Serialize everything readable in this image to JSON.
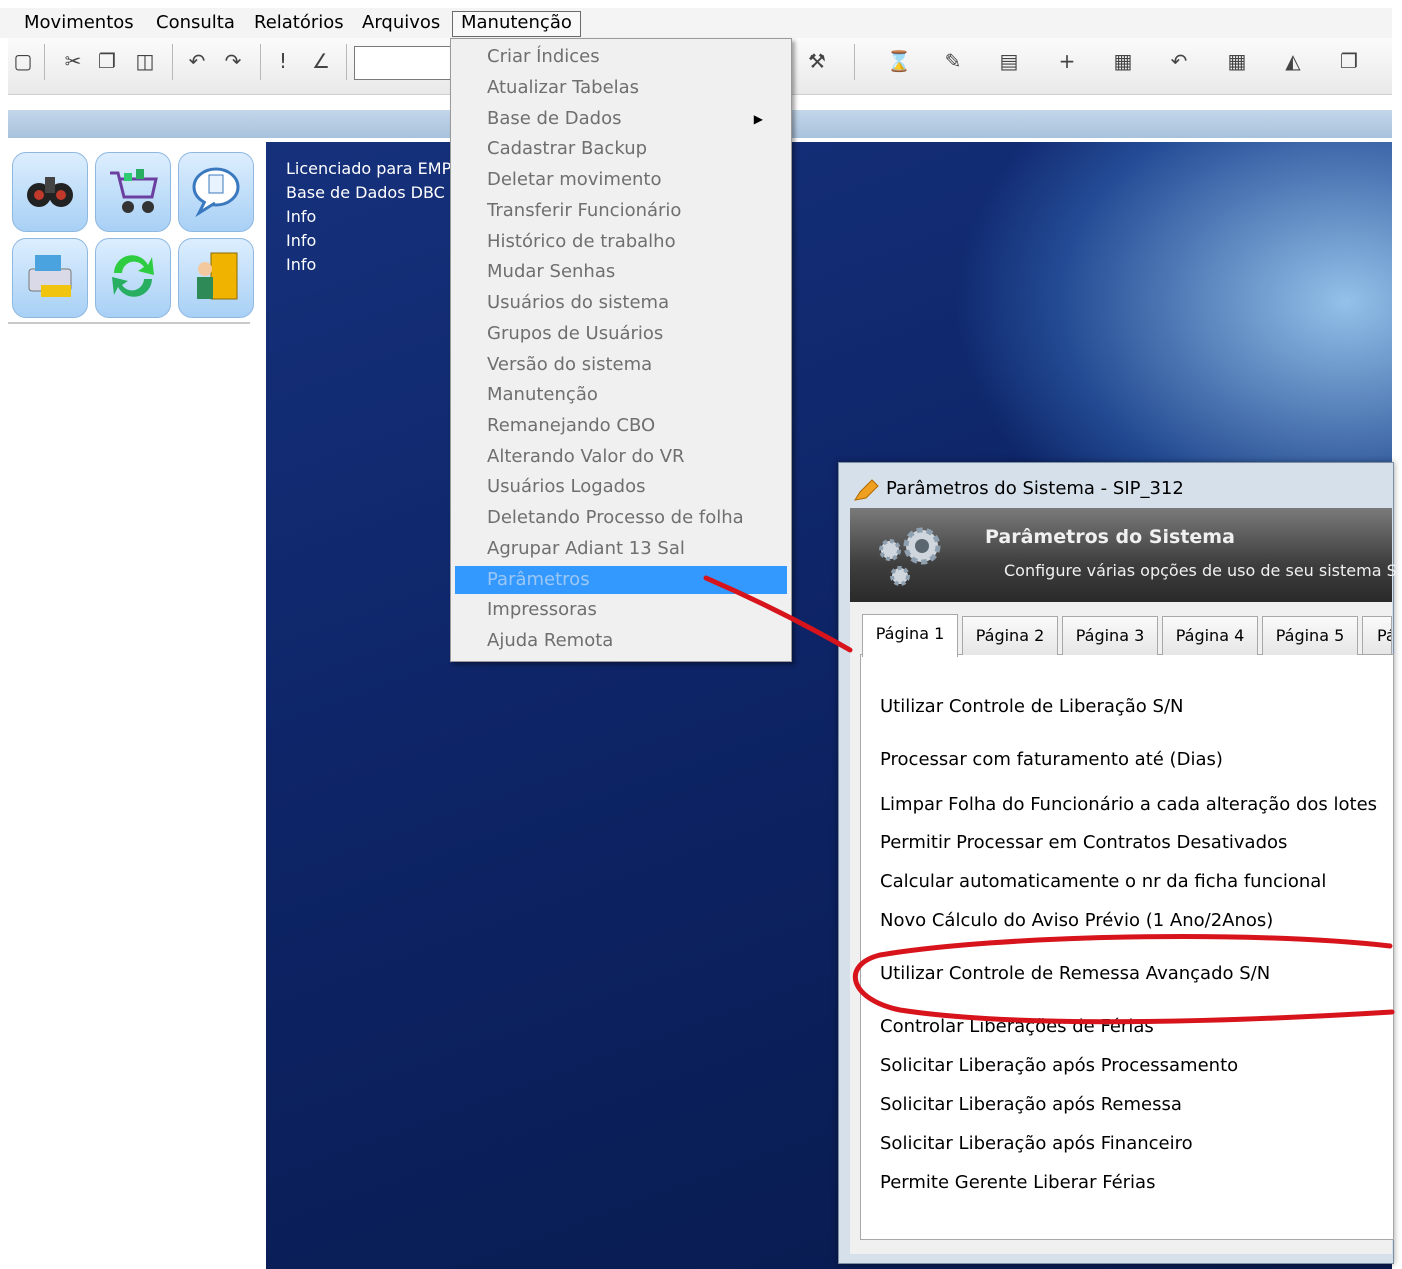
{
  "menubar": {
    "items": [
      {
        "label": "Movimentos"
      },
      {
        "label": "Consulta"
      },
      {
        "label": "Relatórios"
      },
      {
        "label": "Arquivos"
      },
      {
        "label": "Manutenção"
      }
    ]
  },
  "toolbar": {
    "combo_value": "",
    "icons": [
      "preview-icon",
      "cut-icon",
      "copy-icon",
      "paste-icon",
      "undo-icon",
      "redo-icon",
      "alert-icon",
      "chart-icon",
      "tools-icon",
      "hourglass-icon",
      "edit-icon",
      "properties-icon",
      "plus-icon",
      "report-icon",
      "back-icon",
      "grid-icon",
      "folder-icon",
      "clipboard-icon"
    ]
  },
  "launcher": {
    "icons": [
      "binoculars-icon",
      "cart-icon",
      "speech-bubble-icon",
      "printer-icon",
      "refresh-icon",
      "exit-door-icon"
    ]
  },
  "desktop": {
    "info_lines": [
      "Licenciado para EMP",
      "Base de Dados DBC",
      "Info",
      "Info",
      "Info"
    ]
  },
  "dropdown": {
    "items": [
      {
        "label": "Criar Índices"
      },
      {
        "label": "Atualizar Tabelas"
      },
      {
        "label": "Base de Dados",
        "submenu": true
      },
      {
        "label": "Cadastrar Backup"
      },
      {
        "label": "Deletar movimento"
      },
      {
        "label": "Transferir Funcionário"
      },
      {
        "label": "Histórico de trabalho"
      },
      {
        "label": "Mudar Senhas"
      },
      {
        "label": "Usuários do sistema"
      },
      {
        "label": "Grupos de Usuários"
      },
      {
        "label": "Versão do sistema"
      },
      {
        "label": "Manutenção"
      },
      {
        "label": "Remanejando CBO"
      },
      {
        "label": "Alterando Valor do VR"
      },
      {
        "label": "Usuários Logados"
      },
      {
        "label": "Deletando Processo de folha"
      },
      {
        "label": "Agrupar Adiant 13 Sal"
      },
      {
        "label": "Parâmetros",
        "highlighted": true
      },
      {
        "label": "Impressoras"
      },
      {
        "label": "Ajuda Remota"
      }
    ]
  },
  "dialog": {
    "window_title": "Parâmetros do Sistema - SIP_312",
    "header_title": "Parâmetros do Sistema",
    "header_subtitle": "Configure várias opções de uso de seu sistema S",
    "tabs": [
      "Página 1",
      "Página 2",
      "Página 3",
      "Página 4",
      "Página 5",
      "Pá"
    ],
    "active_tab": "Página 1",
    "parameters": [
      "Utilizar Controle de Liberação S/N",
      "Processar com faturamento até (Dias)",
      "Limpar Folha do Funcionário a cada alteração dos lotes",
      "Permitir Processar em Contratos Desativados",
      "Calcular automaticamente o nr da ficha funcional",
      "Novo Cálculo do Aviso Prévio (1 Ano/2Anos)",
      "Utilizar Controle de Remessa Avançado S/N",
      "Controlar Liberações de Férias",
      "Solicitar Liberação após Processamento",
      "Solicitar Liberação após Remessa",
      "Solicitar Liberação após Financeiro",
      "Permite Gerente Liberar Férias"
    ]
  },
  "colors": {
    "annotation_red": "#d7141c",
    "menu_highlight": "#3399ff",
    "desktop_blue": "#0d2466"
  }
}
